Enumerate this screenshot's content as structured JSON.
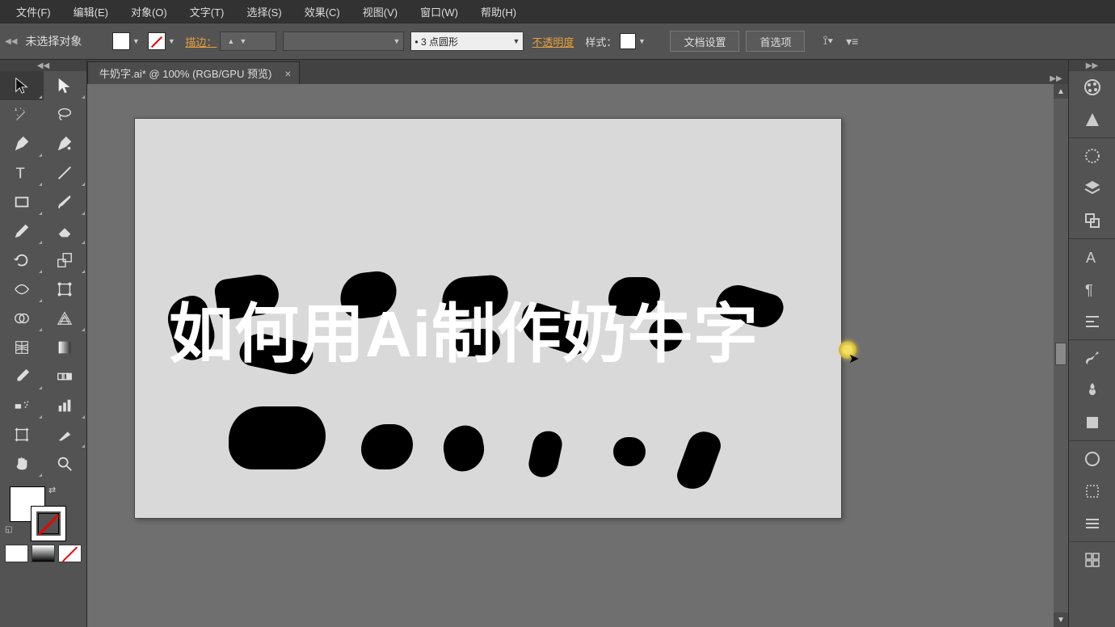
{
  "menu": {
    "items": [
      "文件(F)",
      "编辑(E)",
      "对象(O)",
      "文字(T)",
      "选择(S)",
      "效果(C)",
      "视图(V)",
      "窗口(W)",
      "帮助(H)"
    ]
  },
  "controlbar": {
    "status": "未选择对象",
    "stroke_label": "描边：",
    "stroke_weight": "",
    "brush_preset": "",
    "dash_preset": "• 3 点圆形",
    "opacity_label": "不透明度",
    "style_label": "样式：",
    "doc_setup_btn": "文档设置",
    "prefs_btn": "首选项"
  },
  "document": {
    "tab_title": "牛奶字.ai* @ 100% (RGB/GPU 预览)",
    "artboard_text": "如何用Ai制作奶牛字"
  }
}
